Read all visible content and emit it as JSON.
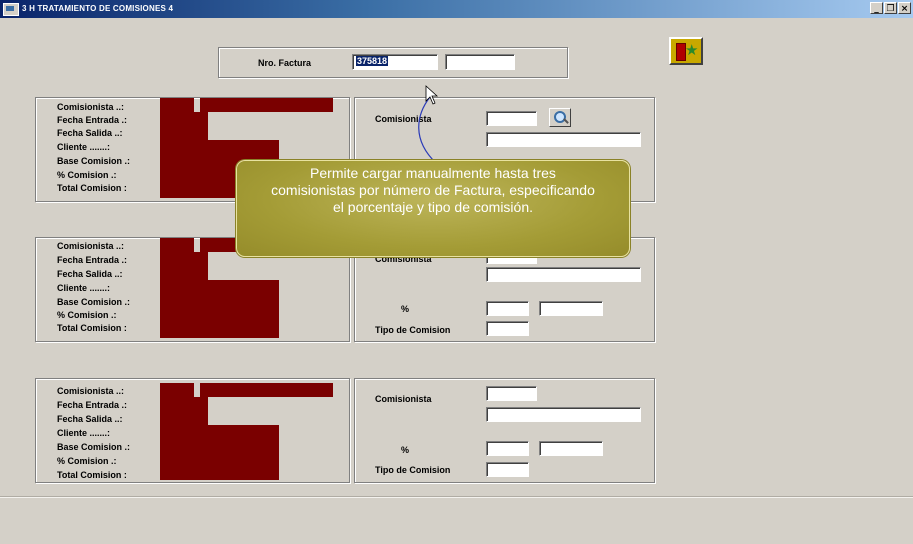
{
  "window": {
    "title": "3 H TRATAMIENTO DE COMISIONES     4",
    "buttons": [
      "_",
      " ",
      "×"
    ]
  },
  "factura": {
    "label": "Nro. Factura",
    "value": "375818",
    "second_value": ""
  },
  "info_labels": [
    "Comisionista ..:",
    "Fecha Entrada .:",
    "Fecha Salida ..:",
    "Cliente .......:",
    "Base Comision .:",
    "% Comision .:",
    "Total Comision :"
  ],
  "right_labels": {
    "comisionista": "Comisionista",
    "percent": "%",
    "tipo": "Tipo de Comision"
  },
  "tooltip": {
    "lines": [
      "Permite cargar manualmente hasta tres",
      "comisionistas por número de Factura, especificando",
      "el porcentaje y tipo de comisión."
    ]
  },
  "icons": {
    "exit": "exit-door-runner-icon",
    "search": "magnifier-icon",
    "cursor": "mouse-pointer-icon"
  },
  "colors": {
    "title_bar": "#0a246a",
    "info_fill": "#7a0000",
    "tooltip_bg": "#a49c36",
    "selected_text_bg": "#0a246a"
  }
}
